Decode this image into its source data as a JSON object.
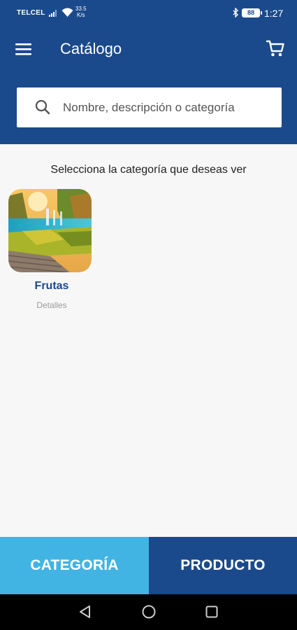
{
  "status_bar": {
    "carrier": "TELCEL",
    "speed_value": "33.5",
    "speed_unit": "K/s",
    "battery": "88",
    "time": "1:27"
  },
  "app_bar": {
    "title": "Catálogo",
    "menu_icon": "hamburger-menu-icon",
    "cart_icon": "shopping-cart-icon"
  },
  "search": {
    "placeholder": "Nombre, descripción o categoría",
    "value": "",
    "icon": "search-icon"
  },
  "instruction": "Selecciona la categoría que deseas ver",
  "categories": [
    {
      "name": "Frutas",
      "detail": "Detalles",
      "image": "waterfall-landscape-photo"
    }
  ],
  "tabs": [
    {
      "label": "CATEGORÍA",
      "active": true
    },
    {
      "label": "PRODUCTO",
      "active": false
    }
  ],
  "nav_bar": {
    "back_icon": "back-triangle-icon",
    "home_icon": "home-circle-icon",
    "recent_icon": "recent-apps-square-icon"
  },
  "colors": {
    "primary": "#1b4a8c",
    "accent": "#41b4e3",
    "background": "#f7f7f7"
  }
}
